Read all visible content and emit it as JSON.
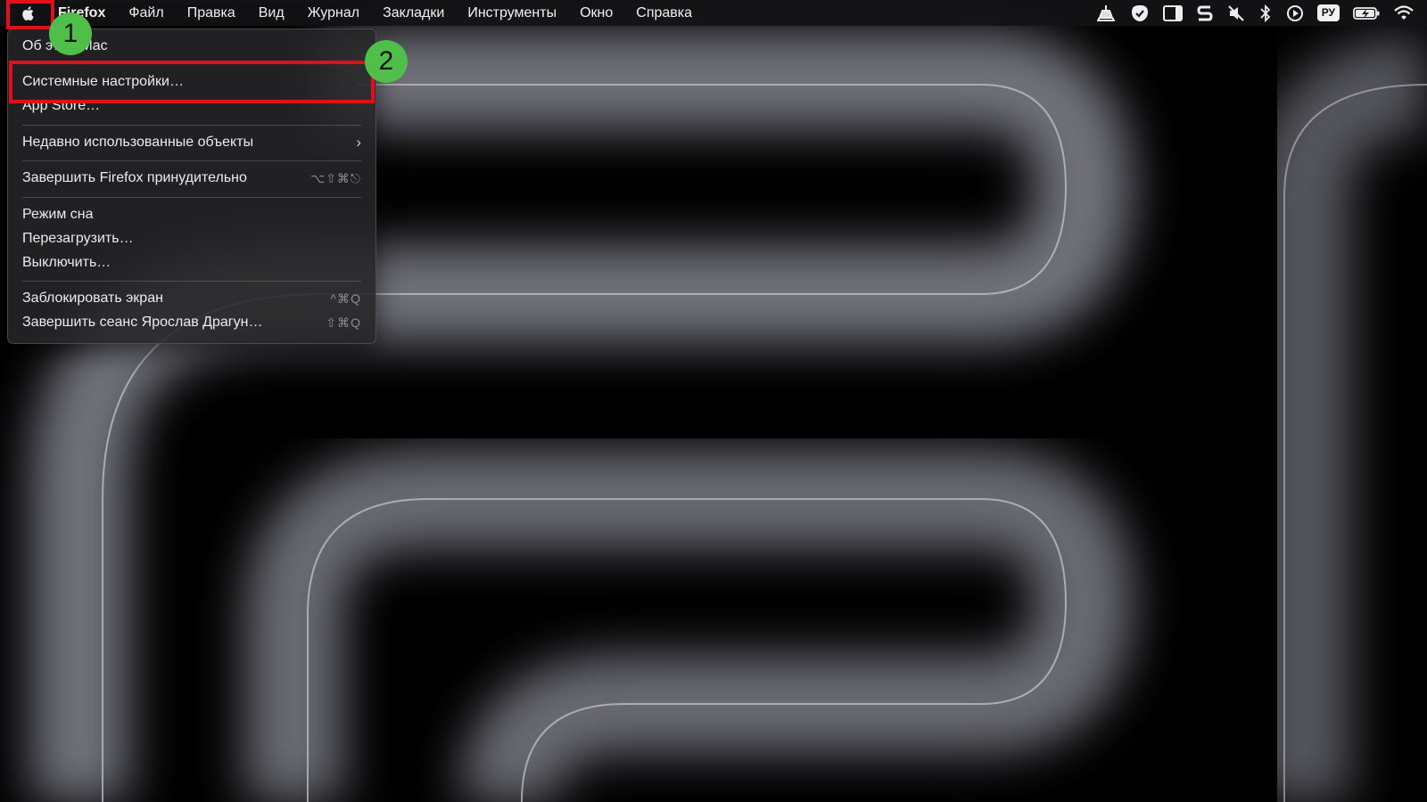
{
  "menubar": {
    "apple_icon": "apple-logo-icon",
    "items": [
      {
        "label": "Firefox",
        "bold": true
      },
      {
        "label": "Файл"
      },
      {
        "label": "Правка"
      },
      {
        "label": "Вид"
      },
      {
        "label": "Журнал"
      },
      {
        "label": "Закладки"
      },
      {
        "label": "Инструменты"
      },
      {
        "label": "Окно"
      },
      {
        "label": "Справка"
      }
    ],
    "status_icons": [
      "printer-stand-icon",
      "check-shield-icon",
      "sidebar-window-icon",
      "s-logo-icon",
      "muted-speaker-icon",
      "bluetooth-icon",
      "play-circle-icon",
      "input-language-icon",
      "battery-charging-icon",
      "wifi-icon"
    ],
    "language": "РУ"
  },
  "apple_menu": {
    "items": [
      {
        "label": "Об этом Mac",
        "shortcut": ""
      },
      {
        "label": "Системные настройки…",
        "shortcut": ""
      },
      {
        "label": "App Store…",
        "shortcut": ""
      },
      {
        "label": "Недавно использованные объекты",
        "shortcut": "",
        "submenu": true
      },
      {
        "label": "Завершить Firefox принудительно",
        "shortcut": "⌥⇧⌘⎋"
      },
      {
        "label": "Режим сна",
        "shortcut": ""
      },
      {
        "label": "Перезагрузить…",
        "shortcut": ""
      },
      {
        "label": "Выключить…",
        "shortcut": ""
      },
      {
        "label": "Заблокировать экран",
        "shortcut": "^⌘Q"
      },
      {
        "label": "Завершить сеанс Ярослав Драгун…",
        "shortcut": "⇧⌘Q"
      }
    ],
    "submenu_icon": "chevron-right-icon"
  },
  "annotations": {
    "step1": "1",
    "step2": "2",
    "highlight_color": "#e0101a",
    "badge_color": "#4fbf49"
  }
}
